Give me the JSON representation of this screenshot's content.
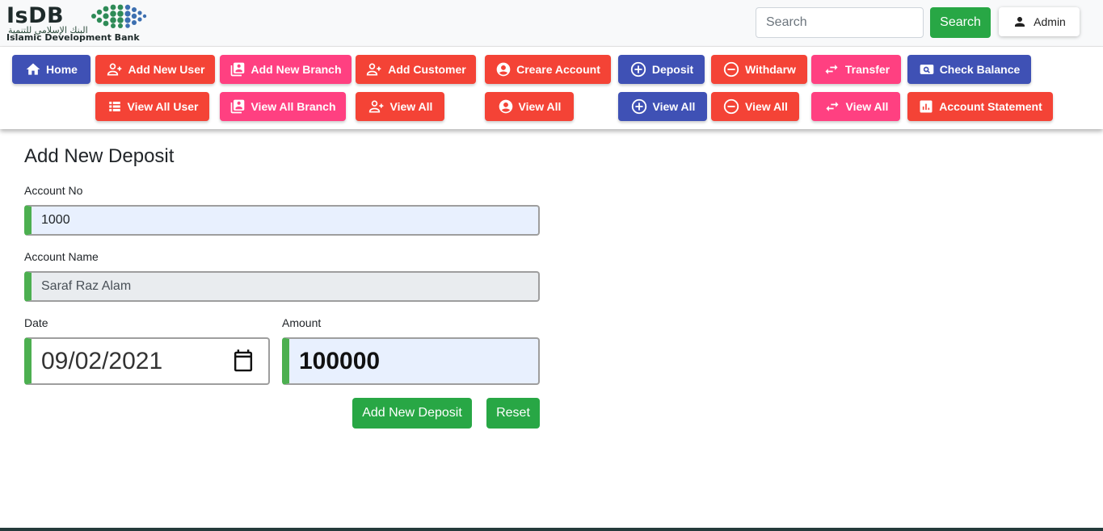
{
  "header": {
    "logo_text": "IsDB",
    "logo_arabic": "البنك الإسلامي للتنمية",
    "logo_subtitle": "Islamic Development Bank",
    "search_placeholder": "Search",
    "search_button": "Search",
    "user_label": "Admin"
  },
  "nav": {
    "home": "Home",
    "add_new_user": "Add New User",
    "add_new_branch": "Add New Branch",
    "add_customer": "Add Customer",
    "create_account": "Creare Account",
    "deposit": "Deposit",
    "withdraw": "Withdarw",
    "transfer": "Transfer",
    "check_balance": "Check Balance",
    "view_all_user": "View All User",
    "view_all_branch": "View All Branch",
    "view_all_customer": "View All",
    "view_all_account": "View All",
    "view_all_deposit": "View All",
    "view_all_withdraw": "View All",
    "view_all_transfer": "View All",
    "account_statement": "Account Statement"
  },
  "form": {
    "title": "Add New Deposit",
    "account_no_label": "Account No",
    "account_no_value": "1000",
    "account_name_label": "Account Name",
    "account_name_value": "Saraf Raz Alam",
    "date_label": "Date",
    "date_value": "09/02/2021",
    "amount_label": "Amount",
    "amount_value": "100000",
    "submit_button": "Add New Deposit",
    "reset_button": "Reset"
  },
  "colors": {
    "blue": "#3f51b5",
    "red": "#f44336",
    "pink": "#ff4081",
    "green": "#28a745",
    "field_accent": "#4caf50"
  }
}
